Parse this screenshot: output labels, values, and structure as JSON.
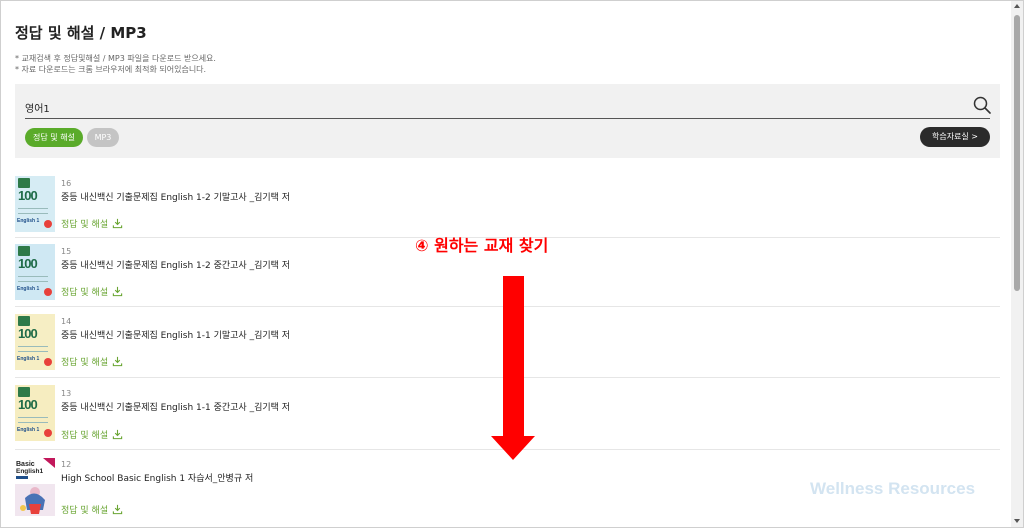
{
  "page": {
    "title": "정답 및 해설 / MP3",
    "notes": [
      "* 교재검색 후 정답및해설 / MP3 파일을 다운로드 받으세요.",
      "* 자료 다운로드는 크롬 브라우저에 최적화 되어있습니다."
    ]
  },
  "search": {
    "value": "영어1",
    "filters": [
      "정답 및 해설",
      "MP3"
    ],
    "active_filter": "정답 및 해설",
    "study_button": "학습자료실 >"
  },
  "items": [
    {
      "number": "16",
      "title": "중등 내신백신 기출문제집 English 1-2 기말고사 _김기택 저",
      "download": "정답 및 해설",
      "cover_color": "#d6ecf4"
    },
    {
      "number": "15",
      "title": "중등 내신백신 기출문제집 English 1-2 중간고사 _김기택 저",
      "download": "정답 및 해설",
      "cover_color": "#cfe8f3"
    },
    {
      "number": "14",
      "title": "중등 내신백신 기출문제집 English 1-1 기말고사 _김기택 저",
      "download": "정답 및 해설",
      "cover_color": "#f6eec4"
    },
    {
      "number": "13",
      "title": "중등 내신백신 기출문제집 English 1-1 중간고사 _김기택 저",
      "download": "정답 및 해설",
      "cover_color": "#f6edc0"
    },
    {
      "number": "12",
      "title": "High School Basic English 1 자습서_안병규 저",
      "download": "정답 및 해설",
      "cover_color": "#f5eef3"
    }
  ],
  "thumb_text": {
    "num": "100",
    "eng": "English 1",
    "basic": "Basic English 1"
  },
  "annotation": {
    "text": "④ 원하는 교재 찾기",
    "color": "#ff0000"
  },
  "watermark": "Wellness Resources",
  "colors": {
    "accent_green": "#5aab2a",
    "download_green": "#6aa533",
    "dark_button": "#2b2b2b"
  }
}
